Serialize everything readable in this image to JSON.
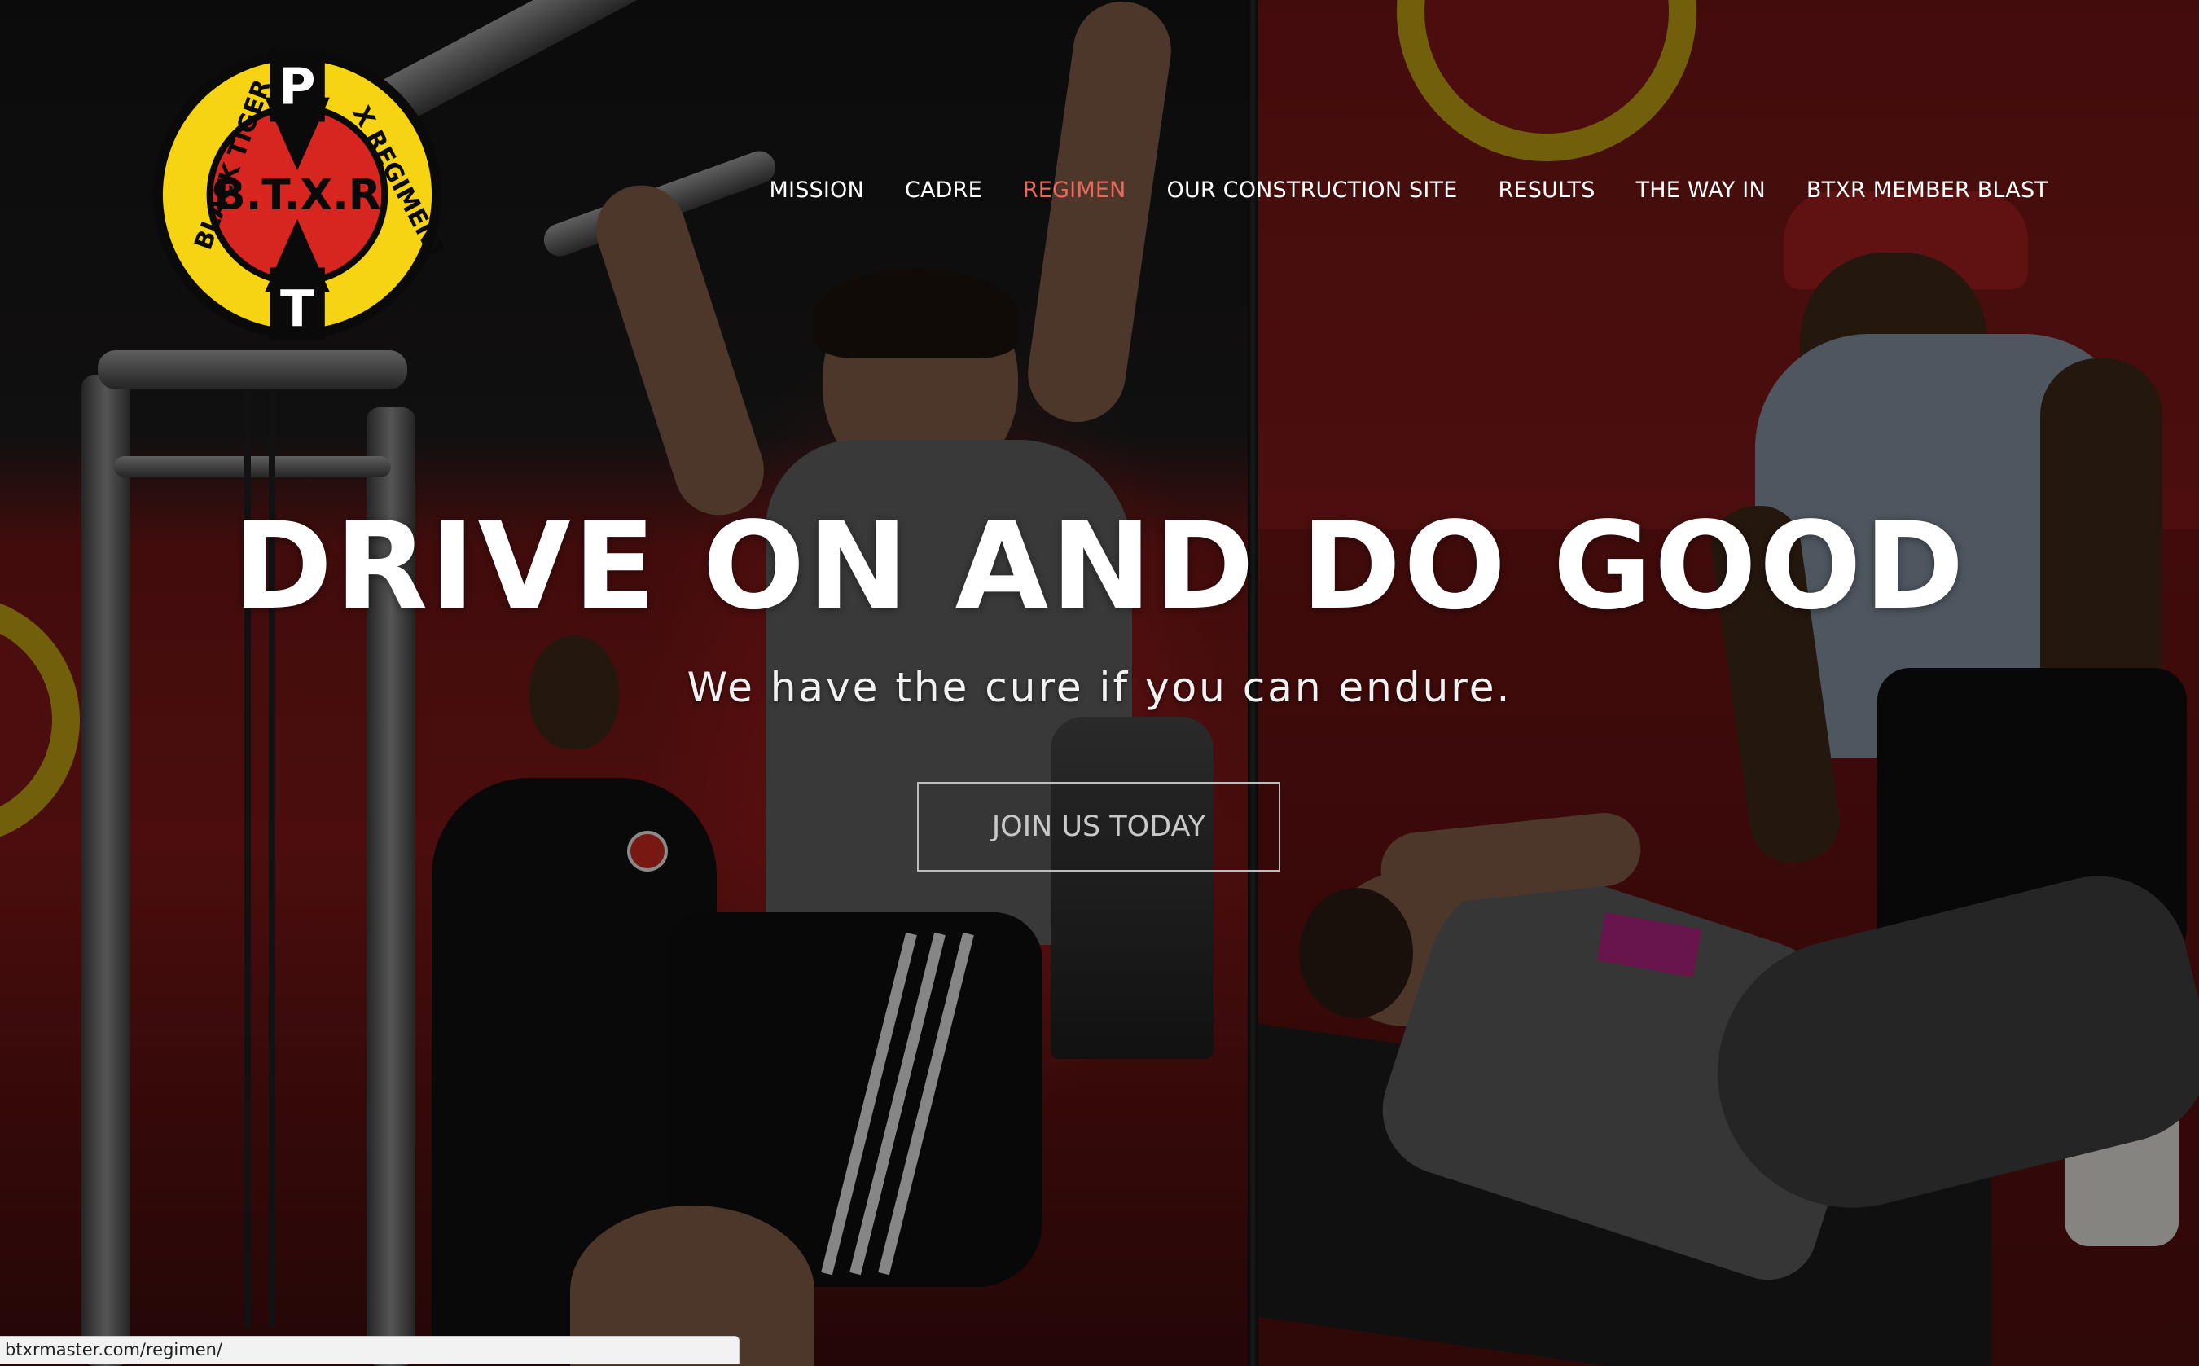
{
  "brand": {
    "logo_center_text": "B.T.X.R",
    "logo_top_letter": "P",
    "logo_bottom_letter": "T",
    "logo_ring_left": "BLACK TIGER",
    "logo_ring_right": "X REGIMENT"
  },
  "nav": {
    "items": [
      {
        "label": "MISSION"
      },
      {
        "label": "CADRE"
      },
      {
        "label": "REGIMEN",
        "active": true
      },
      {
        "label": "OUR CONSTRUCTION SITE"
      },
      {
        "label": "RESULTS"
      },
      {
        "label": "THE WAY IN"
      },
      {
        "label": "BTXR MEMBER BLAST"
      }
    ]
  },
  "hero": {
    "title": "DRIVE ON AND DO GOOD",
    "subtitle": "We have the cure if you can endure.",
    "cta_label": "JOIN US TODAY"
  },
  "status_bar": {
    "url": "btxrmaster.com/regimen/"
  },
  "colors": {
    "nav_active": "#e86a5c",
    "logo_yellow": "#f7d413",
    "logo_red": "#d7261f",
    "logo_black": "#0a0a0a"
  }
}
